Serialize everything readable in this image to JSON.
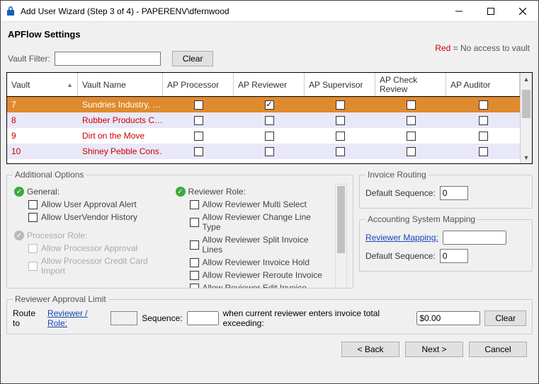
{
  "window": {
    "title": "Add User Wizard (Step 3 of 4) - PAPERENV\\dfernwood"
  },
  "section_title": "APFlow Settings",
  "legend": {
    "red_label": "Red",
    "suffix": " = No access to vault"
  },
  "filter": {
    "label": "Vault Filter:",
    "value": "",
    "clear": "Clear"
  },
  "grid": {
    "headers": {
      "vault": "Vault",
      "vault_name": "Vault Name",
      "ap_processor": "AP Processor",
      "ap_reviewer": "AP Reviewer",
      "ap_supervisor": "AP Supervisor",
      "ap_check_review": "AP Check Review",
      "ap_auditor": "AP Auditor"
    },
    "rows": [
      {
        "vault": "7",
        "name": "Sundries Industry, …",
        "processor": false,
        "reviewer": true,
        "supervisor": false,
        "check": false,
        "auditor": false,
        "selected": true,
        "red": false,
        "alt": false
      },
      {
        "vault": "8",
        "name": "Rubber Products C…",
        "processor": false,
        "reviewer": false,
        "supervisor": false,
        "check": false,
        "auditor": false,
        "selected": false,
        "red": true,
        "alt": true
      },
      {
        "vault": "9",
        "name": "Dirt on the Move",
        "processor": false,
        "reviewer": false,
        "supervisor": false,
        "check": false,
        "auditor": false,
        "selected": false,
        "red": true,
        "alt": false
      },
      {
        "vault": "10",
        "name": "Shiney Pebble Cons…",
        "processor": false,
        "reviewer": false,
        "supervisor": false,
        "check": false,
        "auditor": false,
        "selected": false,
        "red": true,
        "alt": true
      }
    ]
  },
  "additional": {
    "legend": "Additional Options",
    "general": {
      "label": "General:",
      "items": [
        "Allow User Approval Alert",
        "Allow UserVendor History"
      ]
    },
    "processor": {
      "label": "Processor Role:",
      "items": [
        "Allow Processor Approval",
        "Allow Processor Credit Card Import"
      ]
    },
    "reviewer": {
      "label": "Reviewer Role:",
      "items": [
        "Allow Reviewer Multi Select",
        "Allow Reviewer Change Line Type",
        "Allow Reviewer Split Invoice Lines",
        "Allow Reviewer Invoice Hold",
        "Allow Reviewer Reroute Invoice",
        "Allow Reviewer Edit Invoice"
      ]
    }
  },
  "routing": {
    "legend": "Invoice Routing",
    "default_sequence_label": "Default Sequence:",
    "default_sequence_value": "0"
  },
  "mapping": {
    "legend": "Accounting System Mapping",
    "reviewer_mapping_label": "Reviewer Mapping:",
    "reviewer_mapping_value": "",
    "default_sequence_label": "Default Sequence:",
    "default_sequence_value": "0"
  },
  "ral": {
    "legend": "Reviewer Approval Limit",
    "route_to": "Route to",
    "reviewer_role_link": "Reviewer / Role:",
    "sequence_label": "Sequence:",
    "sequence_value": "",
    "tail": "when current reviewer enters invoice total exceeding:",
    "amount": "$0.00",
    "clear": "Clear"
  },
  "buttons": {
    "back": "< Back",
    "next": "Next >",
    "cancel": "Cancel"
  }
}
